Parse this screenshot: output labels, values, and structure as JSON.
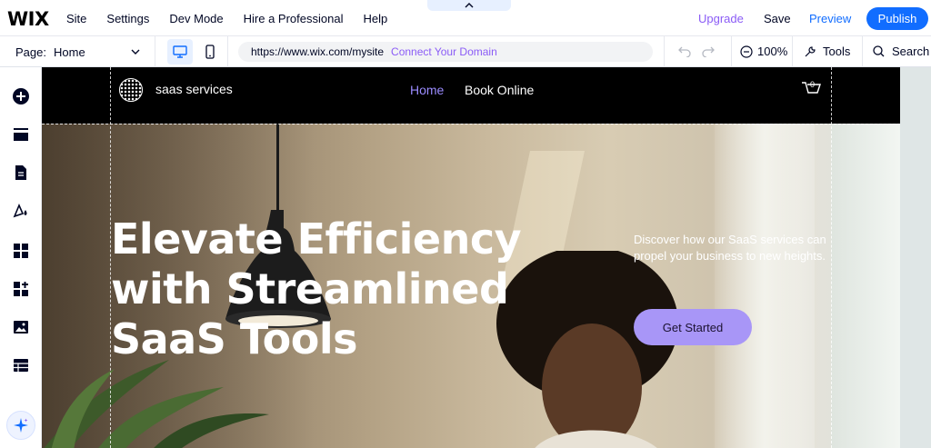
{
  "topbar": {
    "logo": "WIX",
    "menu": [
      "Site",
      "Settings",
      "Dev Mode",
      "Hire a Professional",
      "Help"
    ],
    "upgrade": "Upgrade",
    "save": "Save",
    "preview": "Preview",
    "publish": "Publish",
    "colors": {
      "accent": "#116dff",
      "upgrade": "#8b5cf6"
    }
  },
  "secondbar": {
    "page_label": "Page:",
    "page_value": "Home",
    "url": "https://www.wix.com/mysite",
    "connect_domain": "Connect Your Domain",
    "zoom": "100%",
    "tools": "Tools",
    "search": "Search",
    "icons": [
      "chevron-down-icon",
      "desktop-icon",
      "mobile-icon",
      "undo-icon",
      "redo-icon",
      "zoom-out-icon",
      "tools-icon",
      "search-icon"
    ]
  },
  "leftrail": {
    "icons": [
      "add-icon",
      "sections-icon",
      "pages-icon",
      "design-icon",
      "apps-icon",
      "business-icon",
      "media-icon",
      "cms-icon",
      "ai-assistant-icon"
    ]
  },
  "site": {
    "name": "saas services",
    "nav": [
      "Home",
      "Book Online"
    ],
    "cart_count": "0",
    "hero": {
      "title_lines": [
        "Elevate Efficiency",
        "with Streamlined",
        "SaaS Tools"
      ],
      "subtitle": "Discover how our SaaS services can propel your business to new heights.",
      "cta": "Get Started"
    },
    "colors": {
      "nav_active": "#9b8cff",
      "cta_bg": "#a896f7"
    }
  }
}
